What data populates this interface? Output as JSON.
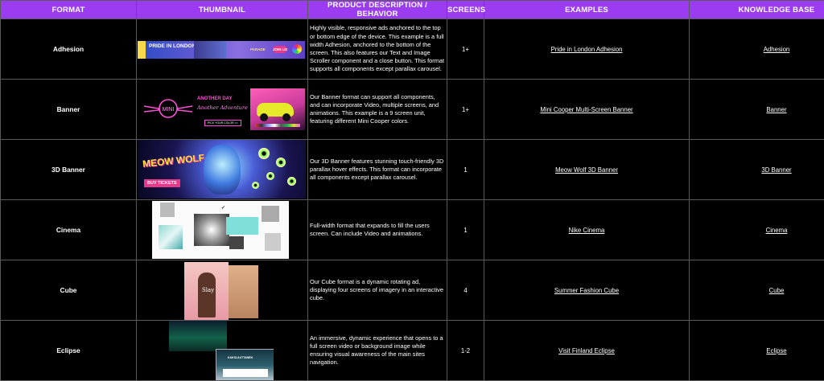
{
  "headers": {
    "format": "FORMAT",
    "thumbnail": "THUMBNAIL",
    "description": "PRODUCT DESCRIPTION / BEHAVIOR",
    "screens": "SCREENS",
    "examples": "EXAMPLES",
    "knowledge_base": "KNOWLEDGE BASE"
  },
  "rows": [
    {
      "format": "Adhesion",
      "thumbnail_text": [
        "PRIDE IN LONDON",
        "JOIN US",
        "PARADE"
      ],
      "description": "Highly visible, responsive ads anchored to the top or bottom edge of the device. This example is a full width Adhesion, anchored to the bottom of the screen. This also features our Text and Image Scroller component and a close button. This format supports all components except parallax carousel.",
      "screens": "1+",
      "example": "Pride in London Adhesion",
      "kb": "Adhesion"
    },
    {
      "format": "Banner",
      "thumbnail_text": [
        "MINI",
        "ANOTHER DAY",
        "Another Adventure",
        "PICK YOUR COLOR >>"
      ],
      "description": "Our Banner format can support all components, and can incorporate Video, multiple screens, and animations.  This example is a 9 screen unit, featuring different Mini Cooper colors.",
      "screens": "1+",
      "example": "Mini Cooper Multi-Screen Banner",
      "kb": "Banner"
    },
    {
      "format": "3D Banner",
      "thumbnail_text": [
        "MEOW WOLF",
        "BUY TICKETS"
      ],
      "description": "Our 3D Banner features stunning touch-friendly 3D parallax hover effects. This format can incorporate all components except parallax carousel.",
      "screens": "1",
      "example": "Meow Wolf 3D Banner",
      "kb": "3D Banner"
    },
    {
      "format": "Cinema",
      "description": "Full-width format that expands to fill the users screen. Can include Video and animations.",
      "screens": "1",
      "example": "Nike Cinema",
      "kb": "Cinema"
    },
    {
      "format": "Cube",
      "thumbnail_text": [
        "Slay"
      ],
      "description": "Our Cube format is a dynamic rotating ad, displaying four screens of imagery in an interactive cube.",
      "screens": "4",
      "example": "Summer Fashion Cube",
      "kb": "Cube"
    },
    {
      "format": "Eclipse",
      "thumbnail_text": [
        "KAKSLAUTTANEN"
      ],
      "description": "An immersive, dynamic experience that opens to a full screen video or background image while ensuring visual awareness of the main sites navigation.",
      "screens": "1-2",
      "example": "Visit Finland Eclipse",
      "kb": "Eclipse"
    }
  ],
  "colors": {
    "header_bg": "#9b3cf2",
    "body_bg": "#000000",
    "border": "#5a5a5a"
  },
  "icons": [
    "car-image",
    "face-image",
    "aurora-image"
  ]
}
